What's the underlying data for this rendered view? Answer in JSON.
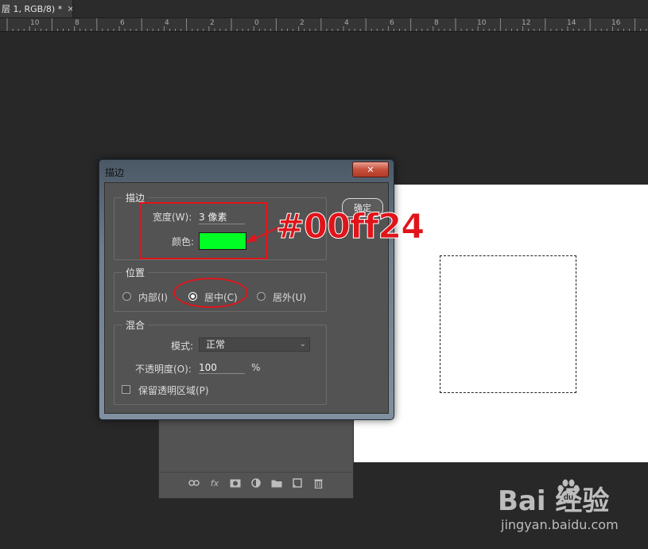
{
  "document_tab": {
    "title": "层 1, RGB/8) *",
    "close_label": "✕"
  },
  "ruler": {
    "labels": [
      "10",
      "8",
      "6",
      "4",
      "2",
      "0",
      "2",
      "4",
      "6",
      "8",
      "10",
      "12",
      "14",
      "16"
    ]
  },
  "dialog": {
    "title": "描边",
    "close_label": "✕",
    "stroke_group": {
      "title": "描边",
      "width_label": "宽度(W):",
      "width_value": "3 像素",
      "color_label": "颜色:",
      "color": "#00ff24"
    },
    "ok_button": "确定",
    "position_group": {
      "title": "位置",
      "options": [
        "内部(I)",
        "居中(C)",
        "居外(U)"
      ],
      "selected": "居中(C)"
    },
    "blend_group": {
      "title": "混合",
      "mode_label": "模式:",
      "mode_value": "正常",
      "opacity_label": "不透明度(O):",
      "opacity_value": "100",
      "opacity_unit": "%",
      "preserve_label": "保留透明区域(P)",
      "preserve_checked": false
    }
  },
  "annotation": {
    "text": "#00ff24",
    "color": "#e0141a"
  },
  "layers_footer": {
    "icons": [
      "link-icon",
      "fx-icon",
      "mask-icon",
      "adjustment-icon",
      "folder-icon",
      "new-layer-icon",
      "trash-icon"
    ],
    "fx_label": "fx"
  },
  "watermark": {
    "brand": "Bai   经验",
    "url": "jingyan.baidu.com"
  }
}
